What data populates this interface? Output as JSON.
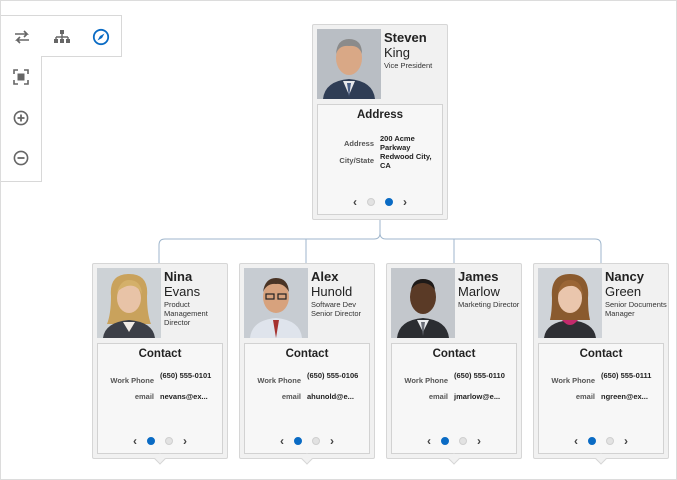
{
  "toolbar": {
    "buttons": [
      "swap-layout-icon",
      "hierarchy-icon",
      "compass-icon",
      "fit-to-screen-icon",
      "zoom-in-icon",
      "zoom-out-icon"
    ],
    "accent": "#0a6bc4"
  },
  "root": {
    "first": "Steven",
    "last": "King",
    "title": "Vice President",
    "panel": "Address",
    "rows": [
      {
        "label": "Address",
        "value": "200 Acme Parkway"
      },
      {
        "label": "City/State",
        "value": "Redwood City, CA"
      }
    ]
  },
  "children": [
    {
      "first": "Nina",
      "last": "Evans",
      "title": "Product Management Director",
      "panel": "Contact",
      "rows": [
        {
          "label": "Work Phone",
          "value": "(650) 555-0101"
        },
        {
          "label": "email",
          "value": "nevans@ex..."
        }
      ]
    },
    {
      "first": "Alex",
      "last": "Hunold",
      "title": "Software Dev Senior Director",
      "panel": "Contact",
      "rows": [
        {
          "label": "Work Phone",
          "value": "(650) 555-0106"
        },
        {
          "label": "email",
          "value": "ahunold@e..."
        }
      ]
    },
    {
      "first": "James",
      "last": "Marlow",
      "title": "Marketing Director",
      "panel": "Contact",
      "rows": [
        {
          "label": "Work Phone",
          "value": "(650) 555-0110"
        },
        {
          "label": "email",
          "value": "jmarlow@e..."
        }
      ]
    },
    {
      "first": "Nancy",
      "last": "Green",
      "title": "Senior Documents Manager",
      "panel": "Contact",
      "rows": [
        {
          "label": "Work Phone",
          "value": "(650) 555-0111"
        },
        {
          "label": "email",
          "value": "ngreen@ex..."
        }
      ]
    }
  ]
}
